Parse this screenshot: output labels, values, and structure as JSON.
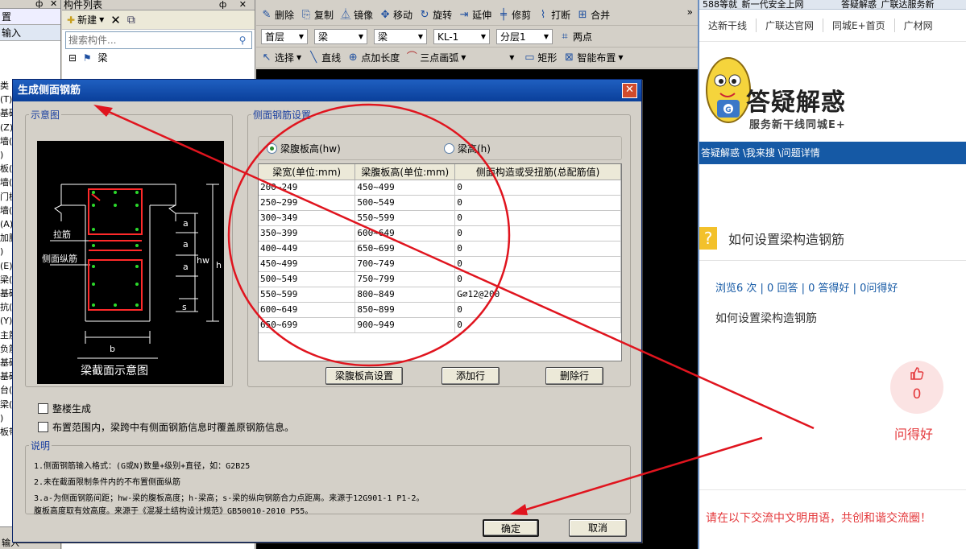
{
  "left_panel": {
    "header_pin": "ф",
    "header_close": "✕",
    "rows": [
      "置",
      "输入"
    ],
    "tree_fragments": [
      "类",
      "(T)",
      "基础",
      "(Z)",
      "墙(",
      ")",
      "板(",
      "墙(",
      "门槛",
      "墙(",
      "(A)",
      "加腋",
      ")",
      "(E)",
      "梁(",
      "基础",
      "抗(",
      "(Y)",
      "主筋",
      "负筋",
      "基础",
      "基础",
      "台(",
      "梁(",
      ")",
      "板带"
    ],
    "bottom_label": "输入"
  },
  "component_panel": {
    "title": "构件列表",
    "controls": "ф ✕",
    "toolbar": {
      "new_label": "新建",
      "delete_icon": "✕",
      "copy_icon": "⧉"
    },
    "search_placeholder": "搜索构件...",
    "tree": {
      "expander": "⊟",
      "item_label": "梁"
    }
  },
  "cad_toolbar": {
    "row1": [
      "删除",
      "复制",
      "镜像",
      "移动",
      "旋转",
      "延伸",
      "修剪",
      "打断",
      "合并"
    ],
    "row2": {
      "floor": "首层",
      "category": "梁",
      "type": "梁",
      "component": "KL-1",
      "layer": "分层1",
      "two_points": "两点"
    },
    "row3": {
      "select": "选择",
      "line": "直线",
      "point_len": "点加长度",
      "arc": "三点画弧",
      "rect": "矩形",
      "smart": "智能布置"
    },
    "more": "»"
  },
  "browser": {
    "tabs": [
      "588等就_新一代安全上网",
      "答疑解惑_广联达服务新"
    ],
    "bookmarks": [
      "达新干线",
      "广联达官网",
      "同城E+首页",
      "广材网"
    ],
    "banner_title": "答疑解惑",
    "banner_sub": "服务新干线同城E+",
    "mascot_letter": "G",
    "nav": "答疑解惑 \\我来搜 \\问题详情",
    "question_icon": "?",
    "question_title": "如何设置梁构造钢筋",
    "stats": "浏览6 次 | 0 回答 | 0 答得好 | 0问得好",
    "question_body": "如何设置梁构造钢筋",
    "like_icon": "👍",
    "like_count": "0",
    "like_label": "问得好",
    "footer_note": "请在以下交流中文明用语，共创和谐交流圈！"
  },
  "dialog": {
    "title": "生成侧面钢筋",
    "close_icon": "✕",
    "diagram_legend": "示意图",
    "diagram_labels": {
      "tie": "拉筋",
      "side_long": "侧面纵筋",
      "caption": "梁截面示意图",
      "a": "a",
      "hw": "hw",
      "h": "h",
      "s": "s",
      "b": "b"
    },
    "settings_legend": "侧面钢筋设置",
    "radio_hw": "梁腹板高(hw)",
    "radio_h": "梁高(h)",
    "table": {
      "headers": [
        "梁宽(单位:mm)",
        "梁腹板高(单位:mm)",
        "侧面构造或受扭筋(总配筋值)"
      ],
      "rows": [
        [
          "200~249",
          "450~499",
          "0"
        ],
        [
          "250~299",
          "500~549",
          "0"
        ],
        [
          "300~349",
          "550~599",
          "0"
        ],
        [
          "350~399",
          "600~649",
          "0"
        ],
        [
          "400~449",
          "650~699",
          "0"
        ],
        [
          "450~499",
          "700~749",
          "0"
        ],
        [
          "500~549",
          "750~799",
          "0"
        ],
        [
          "550~599",
          "800~849",
          "G⌀12@200"
        ],
        [
          "600~649",
          "850~899",
          "0"
        ],
        [
          "650~699",
          "900~949",
          "0"
        ]
      ]
    },
    "btn_web_height": "梁腹板高设置",
    "btn_add_row": "添加行",
    "btn_delete_row": "删除行",
    "chk_whole_building": "整楼生成",
    "chk_overwrite": "布置范围内，梁跨中有侧面钢筋信息时覆盖原钢筋信息。",
    "notes_legend": "说明",
    "notes": [
      "1.侧面钢筋输入格式：(G或N)数量+级别+直径，如：G2B25",
      "2.未在截面限制条件内的不布置侧面纵筋",
      "3.a-为侧面钢筋间距；hw-梁的腹板高度；h-梁高；s-梁的纵向钢筋合力点距离。来源于12G901-1 P1-2。",
      "  腹板高度取有效高度。来源于《混凝土结构设计规范》GB50010-2010 P55。"
    ],
    "btn_ok": "确定",
    "btn_cancel": "取消"
  },
  "annotation_color": "#e0141e"
}
